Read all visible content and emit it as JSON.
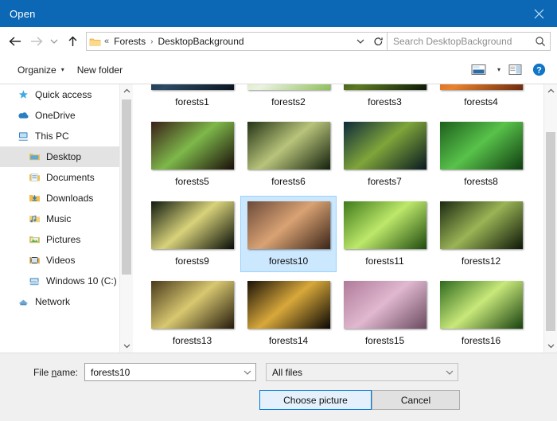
{
  "titlebar": {
    "title": "Open",
    "close_label": "Close"
  },
  "address": {
    "back_icon": "back-arrow-icon",
    "forward_icon": "forward-arrow-icon",
    "history_icon": "recent-locations-chevron-icon",
    "up_icon": "up-arrow-icon",
    "folder_icon": "folder-icon",
    "overflow": "«",
    "crumbs": [
      "Forests",
      "DesktopBackground"
    ],
    "separator": "›",
    "dropdown_icon": "chevron-down-icon",
    "refresh_icon": "refresh-icon"
  },
  "search": {
    "placeholder": "Search DesktopBackground",
    "icon": "search-icon"
  },
  "commandbar": {
    "organize": "Organize",
    "organize_caret": "▾",
    "new_folder": "New folder",
    "view_icon": "view-layout-icon",
    "view_caret": "▾",
    "preview_pane_icon": "preview-pane-icon",
    "help_icon": "help-icon"
  },
  "sidebar": {
    "items": [
      {
        "label": "Quick access",
        "icon": "star-icon",
        "indent": false,
        "selected": false
      },
      {
        "label": "OneDrive",
        "icon": "cloud-icon",
        "indent": false,
        "selected": false
      },
      {
        "label": "This PC",
        "icon": "computer-icon",
        "indent": false,
        "selected": false
      },
      {
        "label": "Desktop",
        "icon": "desktop-folder-icon",
        "indent": true,
        "selected": true
      },
      {
        "label": "Documents",
        "icon": "documents-folder-icon",
        "indent": true,
        "selected": false
      },
      {
        "label": "Downloads",
        "icon": "downloads-folder-icon",
        "indent": true,
        "selected": false
      },
      {
        "label": "Music",
        "icon": "music-folder-icon",
        "indent": true,
        "selected": false
      },
      {
        "label": "Pictures",
        "icon": "pictures-folder-icon",
        "indent": true,
        "selected": false
      },
      {
        "label": "Videos",
        "icon": "videos-folder-icon",
        "indent": true,
        "selected": false
      },
      {
        "label": "Windows 10 (C:)",
        "icon": "drive-icon",
        "indent": true,
        "selected": false
      },
      {
        "label": "Network",
        "icon": "network-icon",
        "indent": false,
        "selected": false
      }
    ]
  },
  "files": {
    "items": [
      {
        "label": "forests1",
        "selected": false,
        "c1": "#0d1a2b",
        "c2": "#2c4a63",
        "c3": "#0a1420"
      },
      {
        "label": "forests2",
        "selected": false,
        "c1": "#c9dfa0",
        "c2": "#e9f2df",
        "c3": "#8fbf5a"
      },
      {
        "label": "forests3",
        "selected": false,
        "c1": "#16260f",
        "c2": "#5c7a22",
        "c3": "#0c1608"
      },
      {
        "label": "forests4",
        "selected": false,
        "c1": "#c24a16",
        "c2": "#e8822f",
        "c3": "#6b2a0c"
      },
      {
        "label": "forests5",
        "selected": false,
        "c1": "#3a1f18",
        "c2": "#7eb84a",
        "c3": "#1a0d09"
      },
      {
        "label": "forests6",
        "selected": false,
        "c1": "#243317",
        "c2": "#b8c47a",
        "c3": "#13200c"
      },
      {
        "label": "forests7",
        "selected": false,
        "c1": "#0e2a3a",
        "c2": "#7fa53a",
        "c3": "#071820"
      },
      {
        "label": "forests8",
        "selected": false,
        "c1": "#1d5f1d",
        "c2": "#58c24a",
        "c3": "#0f3d10"
      },
      {
        "label": "forests9",
        "selected": false,
        "c1": "#101a10",
        "c2": "#d8d27a",
        "c3": "#060c06"
      },
      {
        "label": "forests10",
        "selected": true,
        "c1": "#6b4a3a",
        "c2": "#d9a273",
        "c3": "#3a2418"
      },
      {
        "label": "forests11",
        "selected": false,
        "c1": "#3f7a1c",
        "c2": "#bde86a",
        "c3": "#1e4a0e"
      },
      {
        "label": "forests12",
        "selected": false,
        "c1": "#1c2a12",
        "c2": "#9ab455",
        "c3": "#0d1608"
      },
      {
        "label": "forests13",
        "selected": false,
        "c1": "#4a3a1c",
        "c2": "#d8c870",
        "c3": "#241a0c"
      },
      {
        "label": "forests14",
        "selected": false,
        "c1": "#1a1208",
        "c2": "#d8a83a",
        "c3": "#0a0704"
      },
      {
        "label": "forests15",
        "selected": false,
        "c1": "#b07a9a",
        "c2": "#e0b8cf",
        "c3": "#6a4a60"
      },
      {
        "label": "forests16",
        "selected": false,
        "c1": "#2f6a1e",
        "c2": "#c8e87a",
        "c3": "#18400f"
      }
    ]
  },
  "footer": {
    "filename_label_pre": "File ",
    "filename_label_mnemonic": "n",
    "filename_label_post": "ame:",
    "filename_value": "forests10",
    "filetype_value": "All files",
    "open_button": "Choose picture",
    "cancel_button": "Cancel",
    "dropdown_icon": "chevron-down-icon"
  },
  "colors": {
    "titlebar": "#0c68b5",
    "selection_fill": "#cce8ff",
    "selection_border": "#99d1ff",
    "accent": "#0078d7"
  }
}
